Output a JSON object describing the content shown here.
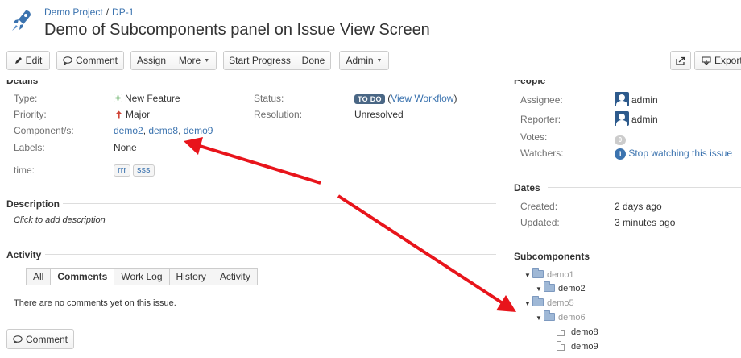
{
  "header": {
    "project": "Demo Project",
    "separator": "/",
    "issue_key": "DP-1",
    "title": "Demo of Subcomponents panel on Issue View Screen"
  },
  "toolbar": {
    "edit": "Edit",
    "comment": "Comment",
    "assign": "Assign",
    "more": "More",
    "start_progress": "Start Progress",
    "done": "Done",
    "admin": "Admin",
    "export": "Export"
  },
  "details": {
    "heading": "Details",
    "type_label": "Type:",
    "type_value": "New Feature",
    "priority_label": "Priority:",
    "priority_value": "Major",
    "components_label": "Component/s:",
    "components": [
      "demo2",
      "demo8",
      "demo9"
    ],
    "labels_label": "Labels:",
    "labels_value": "None",
    "time_label": "time:",
    "time_tags": [
      "rrr",
      "sss"
    ],
    "status_label": "Status:",
    "status_value": "TO DO",
    "view_workflow": "View Workflow",
    "resolution_label": "Resolution:",
    "resolution_value": "Unresolved"
  },
  "description": {
    "heading": "Description",
    "placeholder": "Click to add description"
  },
  "activity": {
    "heading": "Activity",
    "tabs": [
      "All",
      "Comments",
      "Work Log",
      "History",
      "Activity"
    ],
    "active_tab": "Comments",
    "empty": "There are no comments yet on this issue.",
    "comment_button": "Comment"
  },
  "people": {
    "heading": "People",
    "assignee_label": "Assignee:",
    "assignee": "admin",
    "reporter_label": "Reporter:",
    "reporter": "admin",
    "votes_label": "Votes:",
    "votes": "0",
    "watchers_label": "Watchers:",
    "watchers_count": "1",
    "watch_link": "Stop watching this issue"
  },
  "dates": {
    "heading": "Dates",
    "created_label": "Created:",
    "created": "2 days ago",
    "updated_label": "Updated:",
    "updated": "3 minutes ago"
  },
  "subcomponents": {
    "heading": "Subcomponents",
    "tree": [
      {
        "label": "demo1",
        "kind": "folder",
        "selected": false
      },
      {
        "label": "demo2",
        "kind": "folder",
        "selected": true
      },
      {
        "label": "demo5",
        "kind": "folder",
        "selected": false
      },
      {
        "label": "demo6",
        "kind": "folder",
        "selected": false
      },
      {
        "label": "demo8",
        "kind": "file",
        "selected": true
      },
      {
        "label": "demo9",
        "kind": "file",
        "selected": true
      }
    ]
  },
  "colors": {
    "link": "#3b73af",
    "annotation_arrow": "#e8141b",
    "status_lozenge": "#4a6785"
  },
  "icons": [
    "rocket-icon",
    "pencil-icon",
    "speech-bubble-icon",
    "share-icon",
    "export-icon",
    "plus-square-icon",
    "arrow-up-icon",
    "folder-icon",
    "file-icon",
    "triangle-down-icon"
  ]
}
